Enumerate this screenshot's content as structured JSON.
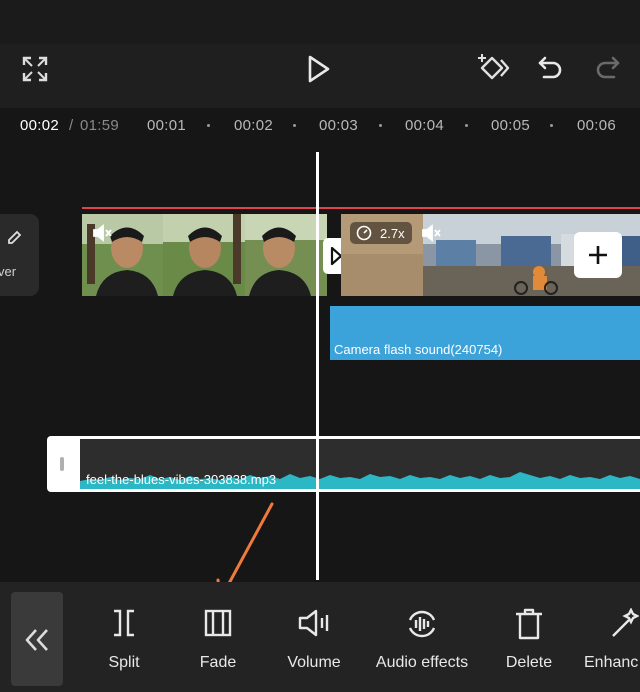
{
  "controls": {
    "play": "play-icon",
    "fullscreen": "fullscreen-icon",
    "keyframe": "keyframe-icon",
    "undo": "undo-icon",
    "redo": "redo-icon"
  },
  "ruler": {
    "current": "00:02",
    "separator": "/",
    "total": "01:59",
    "ticks": [
      "00:01",
      "00:02",
      "00:03",
      "00:04",
      "00:05",
      "00:06"
    ]
  },
  "timeline": {
    "cover_label": "ver",
    "speed_badge": "2.7x",
    "effect_track_label": "Camera flash sound(240754)",
    "audio_track_label": "feel-the-blues-vibes-303838.mp3"
  },
  "toolbar": {
    "items": [
      "Split",
      "Fade",
      "Volume",
      "Audio effects",
      "Delete",
      "Enhanc"
    ]
  },
  "colors": {
    "accent_red": "#e2434b",
    "effect_track": "#3ba3d9",
    "waveform": "#2bb8c4",
    "arrow": "#f07a3b"
  }
}
